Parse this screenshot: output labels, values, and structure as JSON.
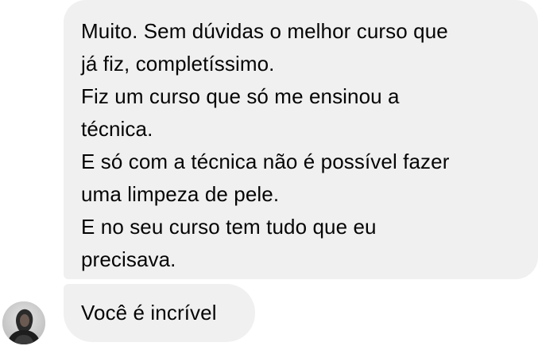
{
  "messages": [
    {
      "paragraphs": [
        [
          "Muito. Sem dúvidas o melhor curso que",
          "já fiz, completíssimo."
        ],
        [
          "Fiz um curso que só me ensinou a",
          "técnica."
        ],
        [
          "E só com a técnica não é possível fazer",
          "uma limpeza de pele."
        ],
        [
          "E no seu curso tem tudo que eu",
          "precisava."
        ]
      ]
    },
    {
      "text": "Você é incrível"
    }
  ],
  "colors": {
    "bubble": "#f0f0f0",
    "text": "#050505",
    "background": "#ffffff"
  },
  "icons": {
    "avatar": "sender-avatar"
  }
}
